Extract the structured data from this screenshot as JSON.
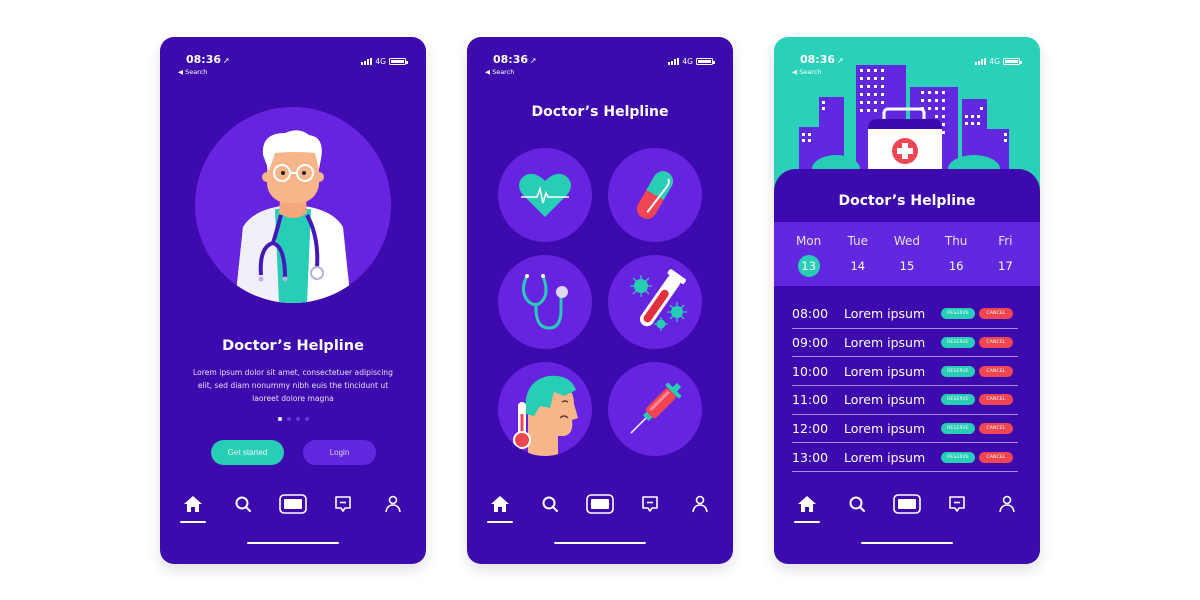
{
  "status_bar": {
    "time": "08:36",
    "location_arrow": "➤",
    "back_label": "◀ Search",
    "network": "4G"
  },
  "colors": {
    "primary": "#3d0aad",
    "secondary": "#6624e0",
    "accent": "#27cdb5",
    "danger": "#f04552"
  },
  "nav": {
    "items": [
      {
        "name": "home",
        "icon": "home-icon",
        "active": true
      },
      {
        "name": "search",
        "icon": "search-icon",
        "active": false
      },
      {
        "name": "card",
        "icon": "card-icon",
        "active": false
      },
      {
        "name": "messages",
        "icon": "message-icon",
        "active": false
      },
      {
        "name": "profile",
        "icon": "user-icon",
        "active": false
      }
    ]
  },
  "screen1": {
    "title": "Doctor’s Helpline",
    "body": "Lorem ipsum dolor sit amet, consectetuer adipiscing elit, sed diam nonummy nibh euis the tincidunt ut laoreet dolore magna",
    "pager": {
      "total": 4,
      "current": 1
    },
    "get_started_label": "Get started",
    "login_label": "Login"
  },
  "screen2": {
    "title": "Doctor’s Helpline",
    "tiles": [
      "heartbeat-icon",
      "pill-icon",
      "stethoscope-icon",
      "blood-test-icon",
      "fever-icon",
      "syringe-icon"
    ]
  },
  "screen3": {
    "title": "Doctor’s Helpline",
    "days": [
      {
        "name": "Mon",
        "date": "13",
        "selected": true
      },
      {
        "name": "Tue",
        "date": "14",
        "selected": false
      },
      {
        "name": "Wed",
        "date": "15",
        "selected": false
      },
      {
        "name": "Thu",
        "date": "16",
        "selected": false
      },
      {
        "name": "Fri",
        "date": "17",
        "selected": false
      }
    ],
    "slots": [
      {
        "time": "08:00",
        "label": "Lorem ipsum"
      },
      {
        "time": "09:00",
        "label": "Lorem ipsum"
      },
      {
        "time": "10:00",
        "label": "Lorem ipsum"
      },
      {
        "time": "11:00",
        "label": "Lorem ipsum"
      },
      {
        "time": "12:00",
        "label": "Lorem ipsum"
      },
      {
        "time": "13:00",
        "label": "Lorem ipsum"
      }
    ],
    "reserve_label": "RESERVE",
    "cancel_label": "CANCEL"
  }
}
